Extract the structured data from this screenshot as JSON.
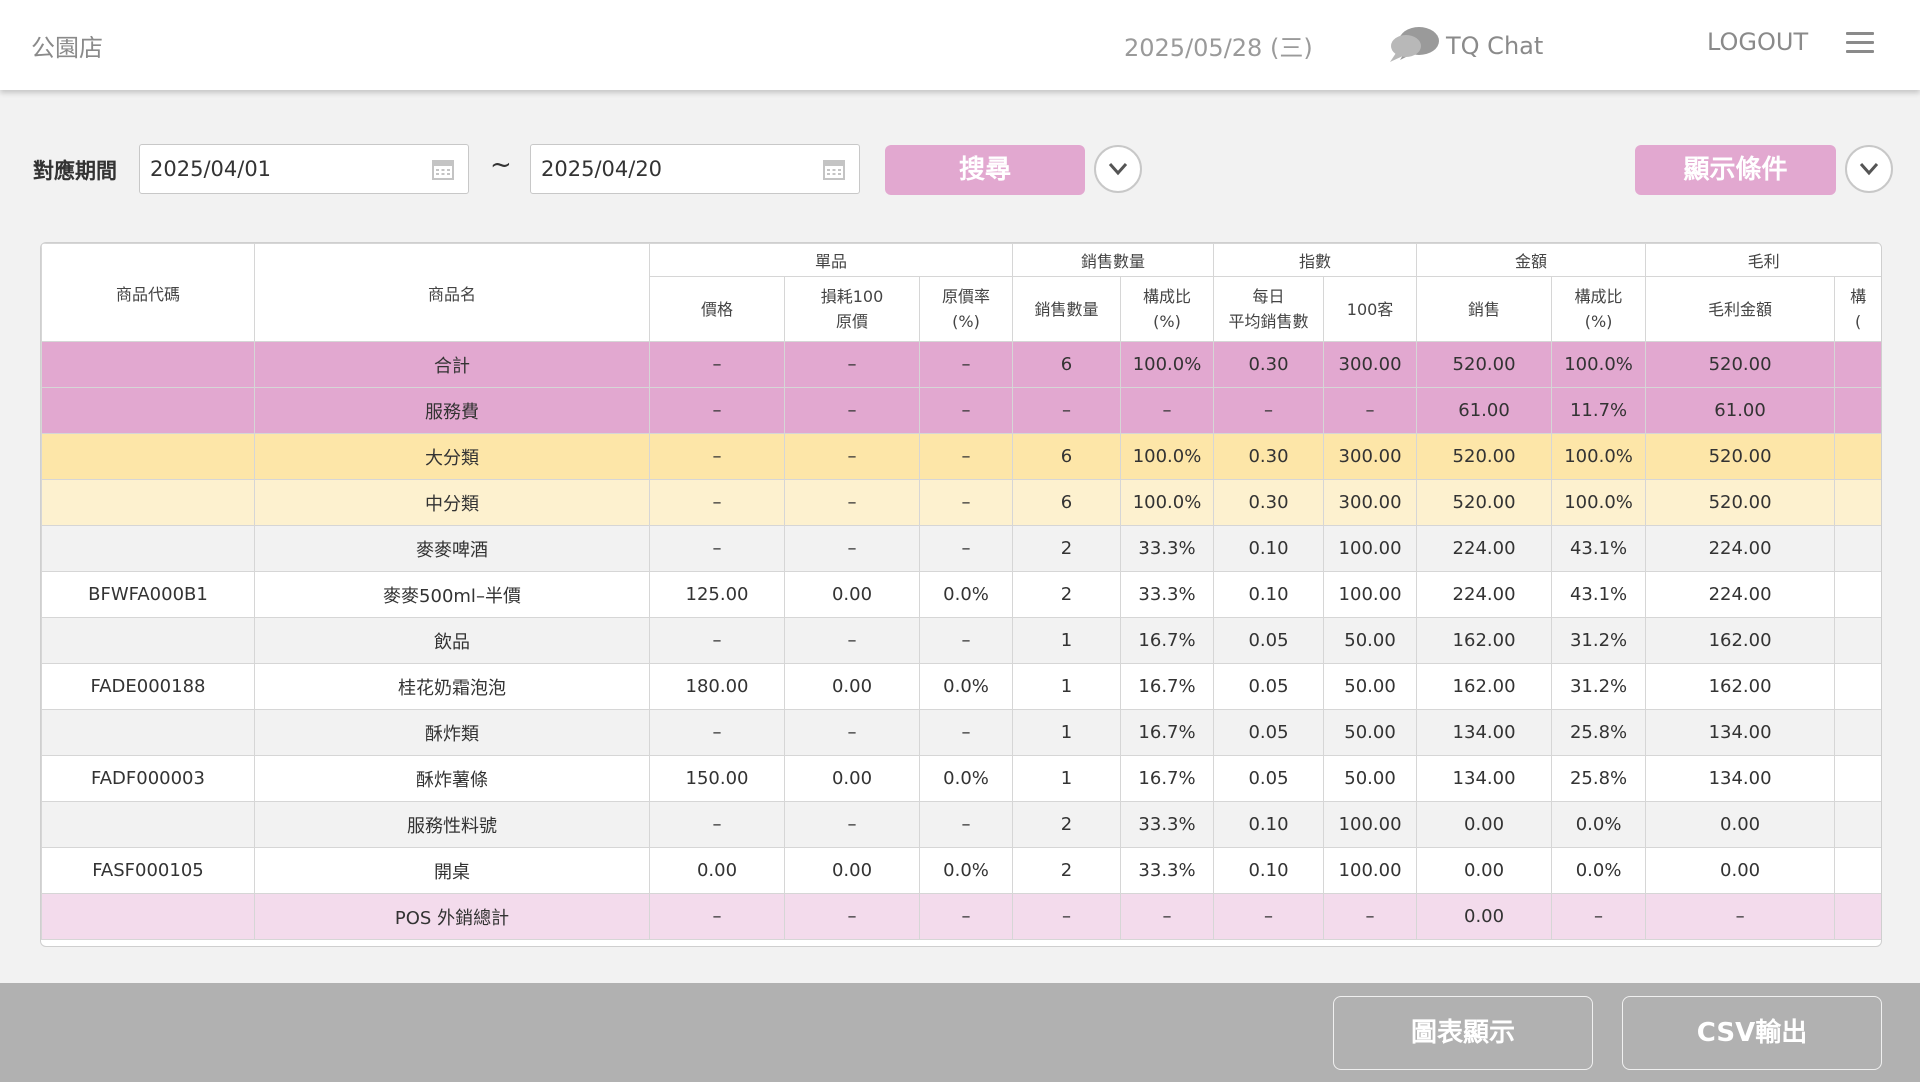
{
  "header": {
    "store_name": "公園店",
    "date": "2025/05/28 (三)",
    "chat_label": "TQ Chat",
    "logout_label": "LOGOUT"
  },
  "filter": {
    "period_label": "對應期間",
    "date_from": "2025/04/01",
    "date_to": "2025/04/20",
    "separator": "~",
    "search_label": "搜尋",
    "display_conditions_label": "顯示條件"
  },
  "table": {
    "group_headers": [
      "單品",
      "銷售數量",
      "指數",
      "金額",
      "毛利"
    ],
    "col_headers": {
      "code": "商品代碼",
      "name": "商品名",
      "price": "價格",
      "loss_cost_1": "損耗100",
      "loss_cost_2": "原價",
      "cost_rate_1": "原價率",
      "cost_rate_2": "(%)",
      "qty": "銷售數量",
      "qty_ratio_1": "構成比",
      "qty_ratio_2": "(%)",
      "daily_avg_1": "每日",
      "daily_avg_2": "平均銷售數",
      "per100": "100客",
      "sales": "銷售",
      "sales_ratio_1": "構成比",
      "sales_ratio_2": "(%)",
      "gp_amount": "毛利金額",
      "gp_ratio_1": "構",
      "gp_ratio_2": "("
    },
    "rows": [
      {
        "type": "total",
        "code": "",
        "name": "合計",
        "price": "–",
        "loss": "–",
        "cost_rate": "–",
        "qty": "6",
        "qty_ratio": "100.0%",
        "daily": "0.30",
        "per100": "300.00",
        "sales": "520.00",
        "sales_ratio": "100.0%",
        "gp": "520.00",
        "gp_ratio": ""
      },
      {
        "type": "svc",
        "code": "",
        "name": "服務費",
        "price": "–",
        "loss": "–",
        "cost_rate": "–",
        "qty": "–",
        "qty_ratio": "–",
        "daily": "–",
        "per100": "–",
        "sales": "61.00",
        "sales_ratio": "11.7%",
        "gp": "61.00",
        "gp_ratio": ""
      },
      {
        "type": "big",
        "code": "",
        "name": "大分類",
        "price": "–",
        "loss": "–",
        "cost_rate": "–",
        "qty": "6",
        "qty_ratio": "100.0%",
        "daily": "0.30",
        "per100": "300.00",
        "sales": "520.00",
        "sales_ratio": "100.0%",
        "gp": "520.00",
        "gp_ratio": ""
      },
      {
        "type": "mid",
        "code": "",
        "name": "中分類",
        "price": "–",
        "loss": "–",
        "cost_rate": "–",
        "qty": "6",
        "qty_ratio": "100.0%",
        "daily": "0.30",
        "per100": "300.00",
        "sales": "520.00",
        "sales_ratio": "100.0%",
        "gp": "520.00",
        "gp_ratio": ""
      },
      {
        "type": "grp",
        "code": "",
        "name": "麥麥啤酒",
        "price": "–",
        "loss": "–",
        "cost_rate": "–",
        "qty": "2",
        "qty_ratio": "33.3%",
        "daily": "0.10",
        "per100": "100.00",
        "sales": "224.00",
        "sales_ratio": "43.1%",
        "gp": "224.00",
        "gp_ratio": ""
      },
      {
        "type": "item",
        "code": "BFWFA000B1",
        "name": "麥麥500ml–半價",
        "price": "125.00",
        "loss": "0.00",
        "cost_rate": "0.0%",
        "qty": "2",
        "qty_ratio": "33.3%",
        "daily": "0.10",
        "per100": "100.00",
        "sales": "224.00",
        "sales_ratio": "43.1%",
        "gp": "224.00",
        "gp_ratio": ""
      },
      {
        "type": "grp",
        "code": "",
        "name": "飲品",
        "price": "–",
        "loss": "–",
        "cost_rate": "–",
        "qty": "1",
        "qty_ratio": "16.7%",
        "daily": "0.05",
        "per100": "50.00",
        "sales": "162.00",
        "sales_ratio": "31.2%",
        "gp": "162.00",
        "gp_ratio": ""
      },
      {
        "type": "item",
        "code": "FADE000188",
        "name": "桂花奶霜泡泡",
        "price": "180.00",
        "loss": "0.00",
        "cost_rate": "0.0%",
        "qty": "1",
        "qty_ratio": "16.7%",
        "daily": "0.05",
        "per100": "50.00",
        "sales": "162.00",
        "sales_ratio": "31.2%",
        "gp": "162.00",
        "gp_ratio": ""
      },
      {
        "type": "grp",
        "code": "",
        "name": "酥炸類",
        "price": "–",
        "loss": "–",
        "cost_rate": "–",
        "qty": "1",
        "qty_ratio": "16.7%",
        "daily": "0.05",
        "per100": "50.00",
        "sales": "134.00",
        "sales_ratio": "25.8%",
        "gp": "134.00",
        "gp_ratio": ""
      },
      {
        "type": "item",
        "code": "FADF000003",
        "name": "酥炸薯條",
        "price": "150.00",
        "loss": "0.00",
        "cost_rate": "0.0%",
        "qty": "1",
        "qty_ratio": "16.7%",
        "daily": "0.05",
        "per100": "50.00",
        "sales": "134.00",
        "sales_ratio": "25.8%",
        "gp": "134.00",
        "gp_ratio": ""
      },
      {
        "type": "grp",
        "code": "",
        "name": "服務性料號",
        "price": "–",
        "loss": "–",
        "cost_rate": "–",
        "qty": "2",
        "qty_ratio": "33.3%",
        "daily": "0.10",
        "per100": "100.00",
        "sales": "0.00",
        "sales_ratio": "0.0%",
        "gp": "0.00",
        "gp_ratio": ""
      },
      {
        "type": "item",
        "code": "FASF000105",
        "name": "開桌",
        "price": "0.00",
        "loss": "0.00",
        "cost_rate": "0.0%",
        "qty": "2",
        "qty_ratio": "33.3%",
        "daily": "0.10",
        "per100": "100.00",
        "sales": "0.00",
        "sales_ratio": "0.0%",
        "gp": "0.00",
        "gp_ratio": ""
      },
      {
        "type": "pos",
        "code": "",
        "name": "POS 外銷總計",
        "price": "–",
        "loss": "–",
        "cost_rate": "–",
        "qty": "–",
        "qty_ratio": "–",
        "daily": "–",
        "per100": "–",
        "sales": "0.00",
        "sales_ratio": "–",
        "gp": "–",
        "gp_ratio": ""
      }
    ]
  },
  "footer": {
    "chart_button": "圖表顯示",
    "csv_button": "CSV輸出"
  },
  "colors": {
    "accent_pink": "#e2a8d0",
    "row_total": "#e2a8d0",
    "row_big_category": "#fde6a8",
    "row_mid_category": "#fdf1cf",
    "row_group": "#f2f2f2",
    "row_pos": "#f3dbec",
    "footer_bg": "#b1b1b1"
  },
  "icons": {
    "chat": "chat-bubble-icon",
    "menu": "hamburger-menu-icon",
    "calendar": "calendar-icon",
    "toggle": "chevron-down-icon"
  }
}
